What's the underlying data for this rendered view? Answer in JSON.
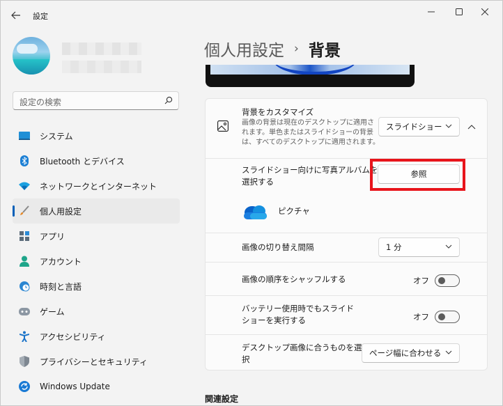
{
  "app": {
    "title": "設定"
  },
  "profile": {
    "name": "",
    "email": ""
  },
  "search": {
    "placeholder": "設定の検索"
  },
  "sidebar": {
    "items": [
      {
        "label": "システム",
        "icon": "monitor-icon"
      },
      {
        "label": "Bluetooth とデバイス",
        "icon": "bluetooth-icon"
      },
      {
        "label": "ネットワークとインターネット",
        "icon": "wifi-icon"
      },
      {
        "label": "個人用設定",
        "icon": "brush-icon",
        "active": true
      },
      {
        "label": "アプリ",
        "icon": "apps-icon"
      },
      {
        "label": "アカウント",
        "icon": "person-icon"
      },
      {
        "label": "時刻と言語",
        "icon": "clock-globe-icon"
      },
      {
        "label": "ゲーム",
        "icon": "gamepad-icon"
      },
      {
        "label": "アクセシビリティ",
        "icon": "accessibility-icon"
      },
      {
        "label": "プライバシーとセキュリティ",
        "icon": "shield-icon"
      },
      {
        "label": "Windows Update",
        "icon": "update-icon"
      }
    ]
  },
  "header": {
    "parent": "個人用設定",
    "separator": "›",
    "current": "背景"
  },
  "background": {
    "title": "背景をカスタマイズ",
    "description_lines": [
      "画像の背景は現在のデスクトップに適用さ",
      "れます。単色またはスライドショーの背景",
      "は、すべてのデスクトップに適用されます。"
    ],
    "type_value": "スライドショー",
    "album_label_lines": [
      "スライドショー向けに写真アルバムを",
      "選択する"
    ],
    "browse_label": "参照",
    "folder_name": "ピクチャ",
    "interval_label": "画像の切り替え間隔",
    "interval_value": "1 分",
    "shuffle_label": "画像の順序をシャッフルする",
    "shuffle_state": "オフ",
    "battery_label_lines": [
      "バッテリー使用時でもスライド",
      "ショーを実行する"
    ],
    "battery_state": "オフ",
    "fit_label_lines": [
      "デスクトップ画像に合うものを選",
      "択"
    ],
    "fit_value": "ページ幅に合わせる"
  },
  "related": {
    "title": "関連設定"
  },
  "colors": {
    "accent": "#005fb8",
    "highlight": "#e8141b"
  }
}
